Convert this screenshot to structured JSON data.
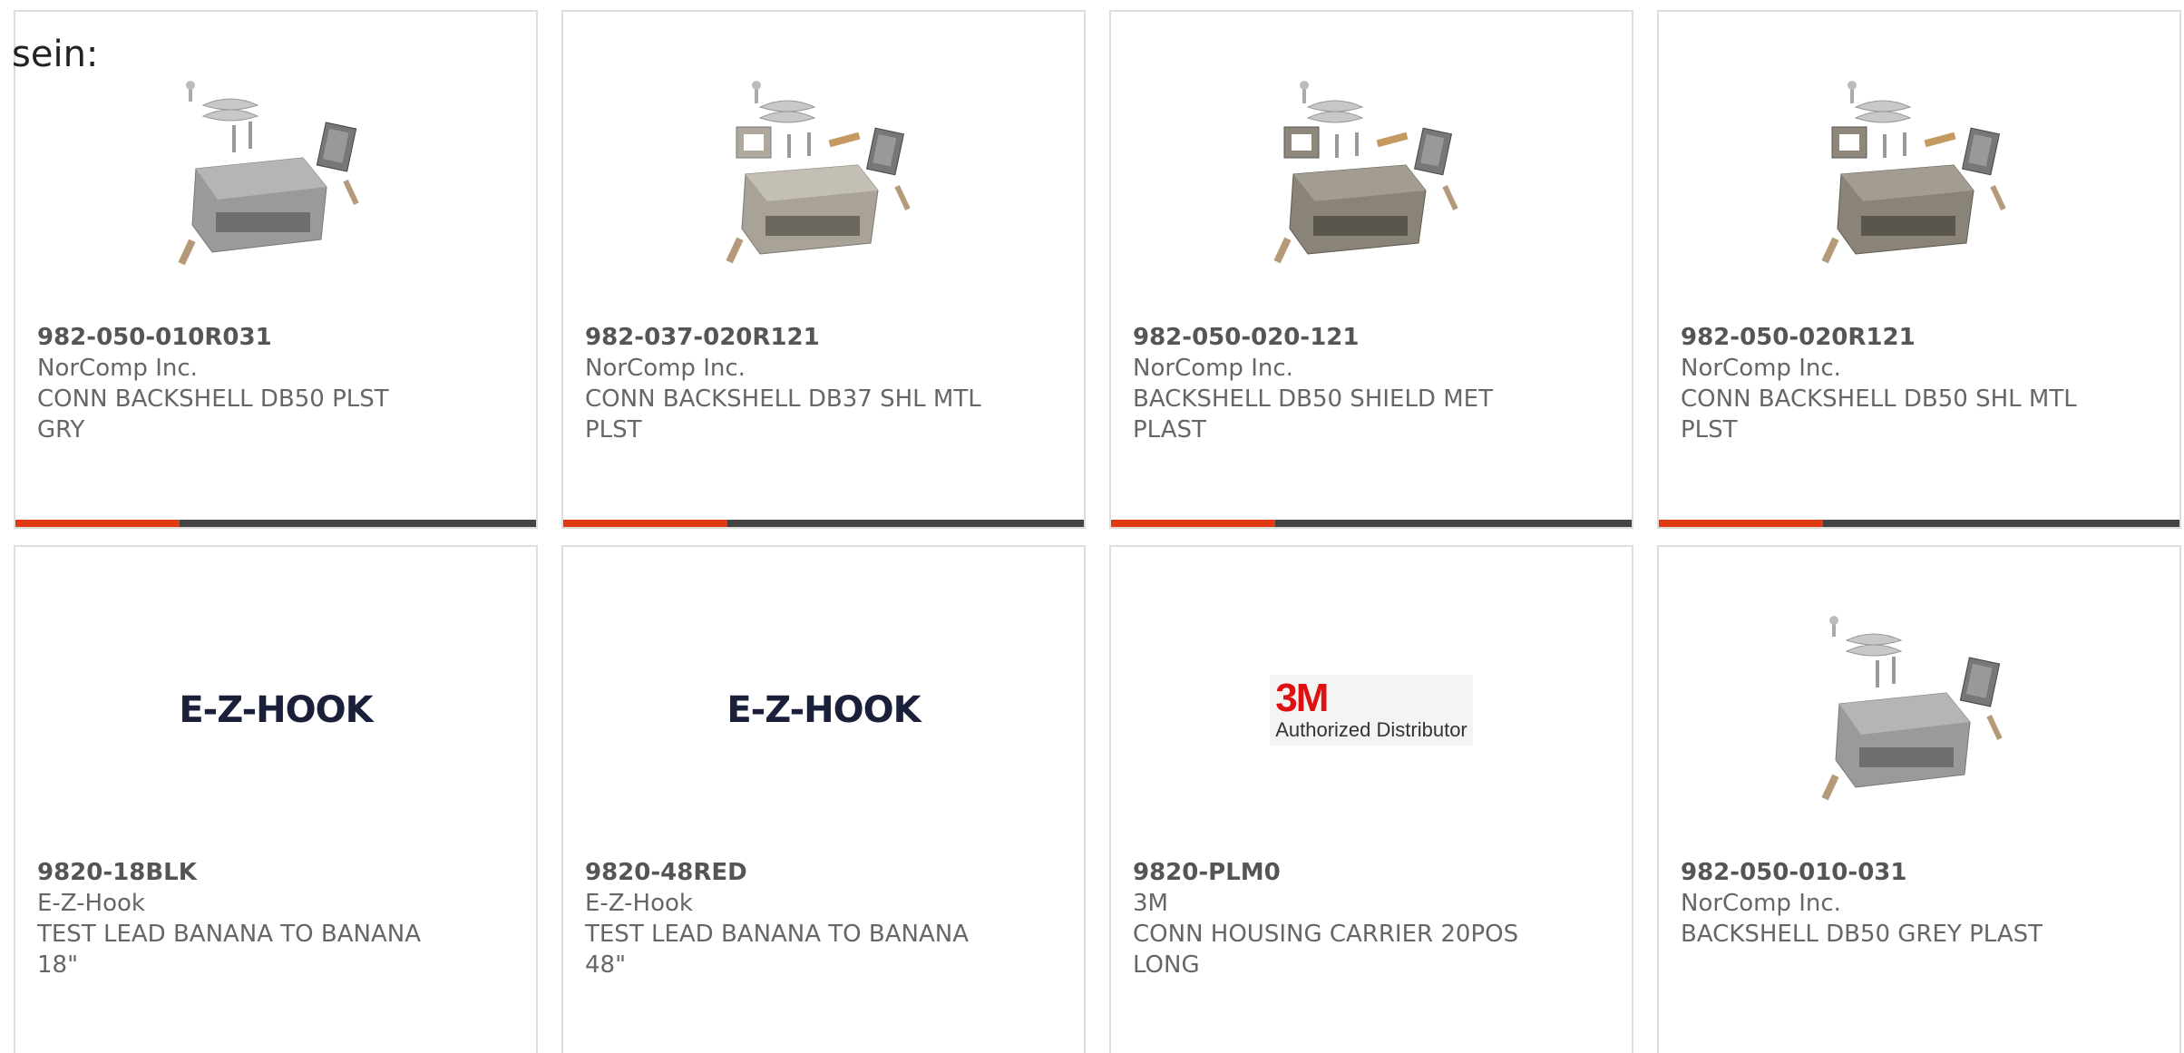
{
  "heading": "sein:",
  "colors": {
    "accent": "#e03a10",
    "bar": "#444444",
    "card_border": "#dddddd",
    "text": "#666666",
    "logo_3m_red": "#e01010",
    "logo_ez_navy": "#1a1f3a"
  },
  "products": [
    {
      "part_number": "982-050-010R031",
      "manufacturer": "NorComp Inc.",
      "description": "CONN BACKSHELL DB50 PLST GRY",
      "image": "backshell-gray-icon",
      "progress": 0.315
    },
    {
      "part_number": "982-037-020R121",
      "manufacturer": "NorComp Inc.",
      "description": "CONN BACKSHELL DB37 SHL MTL PLST",
      "image": "backshell-metal-icon",
      "progress": 0.315
    },
    {
      "part_number": "982-050-020-121",
      "manufacturer": "NorComp Inc.",
      "description": "BACKSHELL DB50 SHIELD MET PLAST",
      "image": "backshell-metal-icon",
      "progress": 0.315
    },
    {
      "part_number": "982-050-020R121",
      "manufacturer": "NorComp Inc.",
      "description": "CONN BACKSHELL DB50 SHL MTL PLST",
      "image": "backshell-metal-icon",
      "progress": 0.315
    },
    {
      "part_number": "9820-18BLK",
      "manufacturer": "E-Z-Hook",
      "description": "TEST LEAD BANANA TO BANANA 18\"",
      "image": "ez-hook-logo",
      "logo_text": "E-Z-HOOK"
    },
    {
      "part_number": "9820-48RED",
      "manufacturer": "E-Z-Hook",
      "description": "TEST LEAD BANANA TO BANANA 48\"",
      "image": "ez-hook-logo",
      "logo_text": "E-Z-HOOK"
    },
    {
      "part_number": "9820-PLM0",
      "manufacturer": "3M",
      "description": "CONN HOUSING CARRIER 20POS LONG",
      "image": "3m-logo",
      "logo_text": "3M",
      "logo_subtext": "Authorized Distributor"
    },
    {
      "part_number": "982-050-010-031",
      "manufacturer": "NorComp Inc.",
      "description": "BACKSHELL DB50 GREY PLAST",
      "image": "backshell-gray-icon"
    }
  ]
}
